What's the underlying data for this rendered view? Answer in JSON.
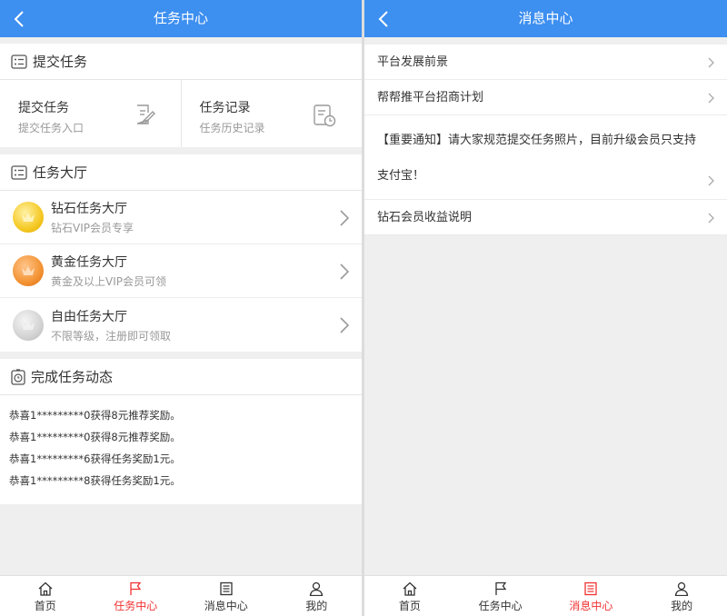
{
  "left": {
    "nav_title": "任务中心",
    "submit_section": {
      "title": "提交任务",
      "cells": [
        {
          "title": "提交任务",
          "subtitle": "提交任务入口",
          "icon": "edit-document-icon"
        },
        {
          "title": "任务记录",
          "subtitle": "任务历史记录",
          "icon": "history-record-icon"
        }
      ]
    },
    "hall_section": {
      "title": "任务大厅",
      "items": [
        {
          "title": "钻石任务大厅",
          "subtitle": "钻石VIP会员专享",
          "medal": "gold"
        },
        {
          "title": "黄金任务大厅",
          "subtitle": "黄金及以上VIP会员可领",
          "medal": "bronze"
        },
        {
          "title": "自由任务大厅",
          "subtitle": "不限等级，注册即可领取",
          "medal": "silver"
        }
      ]
    },
    "feed_section": {
      "title": "完成任务动态",
      "lines": [
        "恭喜1*********0获得8元推荐奖励。",
        "恭喜1*********0获得8元推荐奖励。",
        "恭喜1*********6获得任务奖励1元。",
        "恭喜1*********8获得任务奖励1元。"
      ]
    },
    "active_tab": 1
  },
  "right": {
    "nav_title": "消息中心",
    "messages": [
      {
        "text": "平台发展前景"
      },
      {
        "text": "帮帮推平台招商计划"
      },
      {
        "text": "【重要通知】请大家规范提交任务照片，目前升级会员只支持支付宝！"
      },
      {
        "text": "钻石会员收益说明"
      }
    ],
    "active_tab": 2
  },
  "tabs": [
    {
      "label": "首页",
      "icon": "home-icon"
    },
    {
      "label": "任务中心",
      "icon": "flag-icon"
    },
    {
      "label": "消息中心",
      "icon": "list-icon"
    },
    {
      "label": "我的",
      "icon": "user-icon"
    }
  ],
  "colors": {
    "nav": "#3d8ff0",
    "active_tab": "#f23131",
    "background": "#efefef"
  }
}
